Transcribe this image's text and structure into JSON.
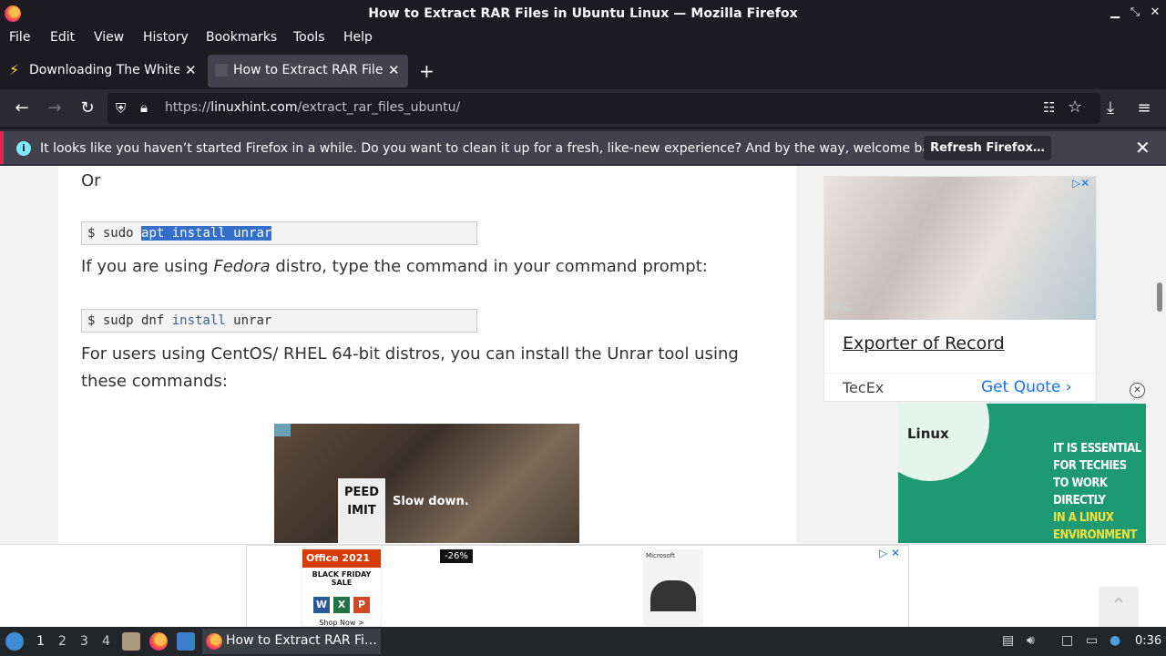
{
  "window": {
    "title": "How to Extract RAR Files in Ubuntu Linux — Mozilla Firefox",
    "controls": [
      "minimize-icon",
      "restore-icon",
      "close-icon"
    ]
  },
  "menu": [
    "File",
    "Edit",
    "View",
    "History",
    "Bookmarks",
    "Tools",
    "Help"
  ],
  "tabs": [
    {
      "label": "Downloading The White H",
      "active": false
    },
    {
      "label": "How to Extract RAR Files",
      "active": true
    }
  ],
  "nav": {
    "url_prefix": "https://",
    "url_domain": "linuxhint.com",
    "url_path": "/extract_rar_files_ubuntu/"
  },
  "notification": {
    "message": "It looks like you haven’t started Firefox in a while. Do you want to clean it up for a fresh, like-new experience? And by the way, welcome back!",
    "button": "Refresh Firefox…"
  },
  "article": {
    "or": "Or",
    "code1_prompt": "$ sudo ",
    "code1_selected": "apt install unrar",
    "fedora_pre": "If you are using ",
    "fedora_em": "Fedora",
    "fedora_post": " distro, type the command in your command prompt:",
    "code2_prompt": "$ sudp dnf ",
    "code2_kw": "install",
    "code2_rest": " unrar",
    "centos_line1": "For users using CentOS/ RHEL 64-bit distros, you can install the Unrar tool using",
    "centos_line2": "these commands:",
    "video_caption": "Slow down.",
    "video_sign": "PEED IMIT"
  },
  "ad_right": {
    "headline": "Exporter of Record",
    "brand": "TecEx",
    "cta": "Get Quote",
    "logo_text": "TEC"
  },
  "ad_linux": {
    "logo": "Linux",
    "lines": [
      "IT IS ESSENTIAL",
      "FOR TECHIES",
      "TO WORK DIRECTLY",
      "IN A LINUX",
      "ENVIRONMENT"
    ]
  },
  "ad_bottom": {
    "office_title": "Office 2021",
    "office_sub": "BLACK FRIDAY SALE",
    "shop": "Shop Now >",
    "discount": "-26%",
    "ms_label": "Microsoft"
  },
  "taskbar": {
    "workspaces": [
      "1",
      "2",
      "3",
      "4"
    ],
    "task_label": "How to Extract RAR Fi…",
    "clock": "0:36"
  }
}
